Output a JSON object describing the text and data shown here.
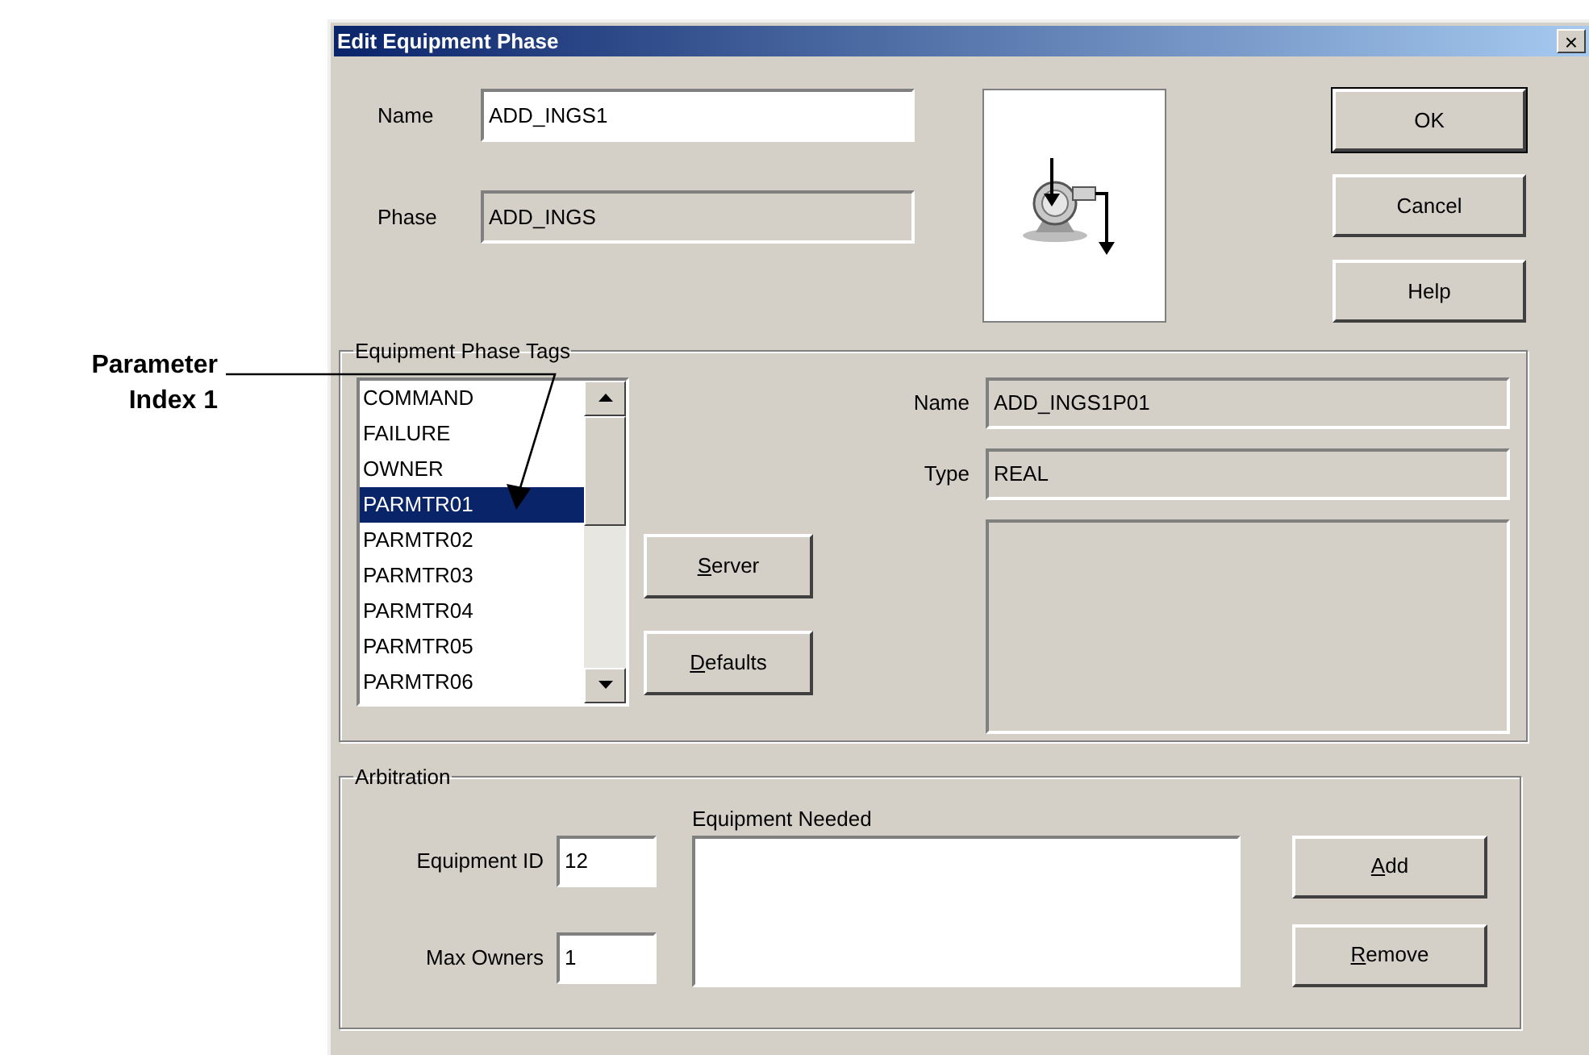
{
  "annotation": {
    "lines": [
      "Parameter",
      "Index 1"
    ]
  },
  "window": {
    "title": "Edit Equipment Phase",
    "close": "×"
  },
  "fields": [
    {
      "label": "Name",
      "value": "ADD_INGS1",
      "disabled": false
    },
    {
      "label": "Phase",
      "value": "ADD_INGS",
      "disabled": true
    }
  ],
  "buttons": [
    {
      "label": "OK",
      "default": true
    },
    {
      "label": "Cancel",
      "default": false
    },
    {
      "label": "Help",
      "default": false
    }
  ],
  "tags_group": {
    "title": "Equipment Phase Tags",
    "items": [
      {
        "label": "COMMAND",
        "selected": false
      },
      {
        "label": "FAILURE",
        "selected": false
      },
      {
        "label": "OWNER",
        "selected": false
      },
      {
        "label": "PARMTR01",
        "selected": true
      },
      {
        "label": "PARMTR02",
        "selected": false
      },
      {
        "label": "PARMTR03",
        "selected": false
      },
      {
        "label": "PARMTR04",
        "selected": false
      },
      {
        "label": "PARMTR05",
        "selected": false
      },
      {
        "label": "PARMTR06",
        "selected": false
      }
    ],
    "buttons": [
      {
        "label": "Server",
        "access_key_underlined": true
      },
      {
        "label": "Defaults",
        "access_key_underlined": true
      }
    ],
    "details": [
      {
        "label": "Name",
        "value": "ADD_INGS1P01"
      },
      {
        "label": "Type",
        "value": "REAL"
      }
    ]
  },
  "arbitration": {
    "title": "Arbitration",
    "list_label": "Equipment Needed",
    "fields": [
      {
        "label": "Equipment ID",
        "value": "12"
      },
      {
        "label": "Max Owners",
        "value": "1"
      }
    ],
    "buttons": [
      {
        "label": "Add",
        "access_key_underlined": true
      },
      {
        "label": "Remove",
        "access_key_underlined": true
      }
    ]
  }
}
